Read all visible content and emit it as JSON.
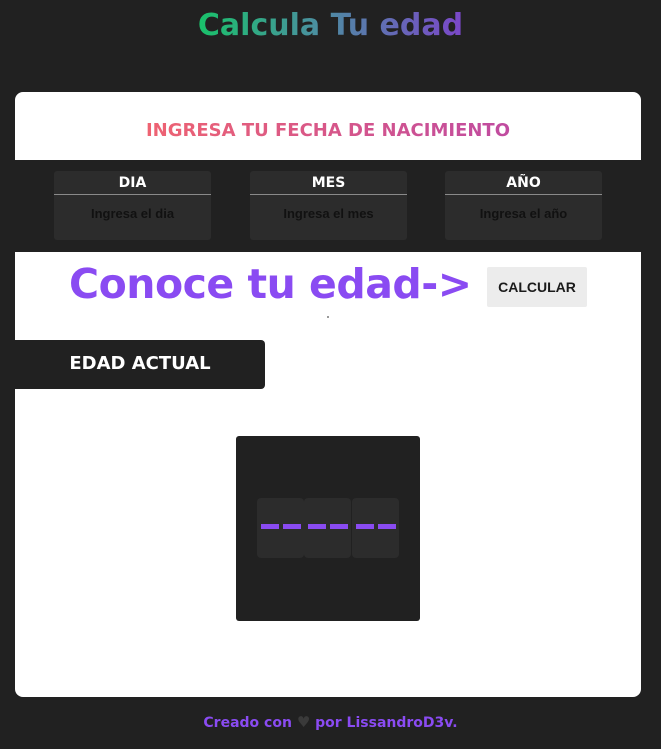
{
  "app": {
    "title": "Calcula Tu edad"
  },
  "form": {
    "heading": "INGRESA TU FECHA DE NACIMIENTO",
    "fields": [
      {
        "label": "DIA",
        "placeholder": "Ingresa el dia"
      },
      {
        "label": "MES",
        "placeholder": "Ingresa el mes"
      },
      {
        "label": "AÑO",
        "placeholder": "Ingresa el año"
      }
    ]
  },
  "cta": {
    "text": "Conoce tu edad->",
    "button_label": "CALCULAR"
  },
  "result": {
    "tab_label": "EDAD ACTUAL",
    "digits": [
      "--",
      "--",
      "--"
    ]
  },
  "footer": {
    "prefix": "Creado con",
    "heart_icon": "heart-icon",
    "suffix": "por LissandroD3v."
  },
  "colors": {
    "accent": "#8a4bf2",
    "background": "#212121",
    "title_gradient": [
      "#19c16a",
      "#7b47c9"
    ],
    "heading_gradient": [
      "#ee6372",
      "#c04ba0"
    ]
  }
}
